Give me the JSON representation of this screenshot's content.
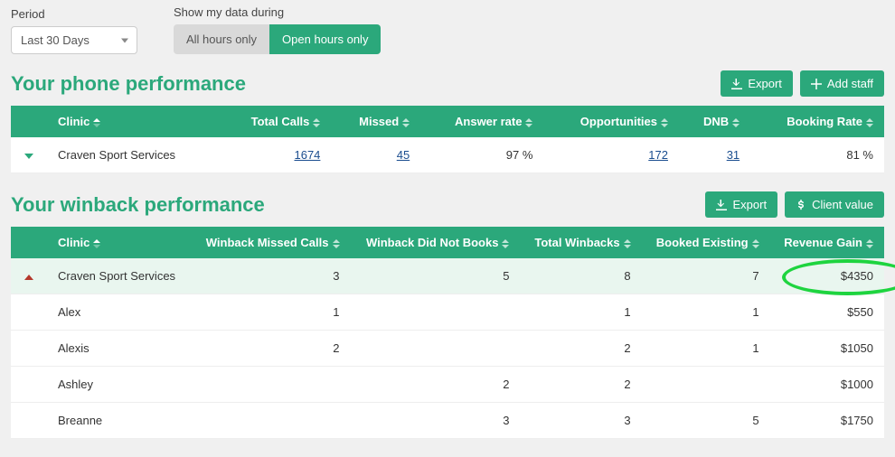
{
  "controls": {
    "period_label": "Period",
    "period_value": "Last 30 Days",
    "hours_label": "Show my data during",
    "hours_opt_all": "All hours only",
    "hours_opt_open": "Open hours only"
  },
  "phone": {
    "title": "Your phone performance",
    "export_label": "Export",
    "add_staff_label": "Add staff",
    "cols": {
      "clinic": "Clinic",
      "total_calls": "Total Calls",
      "missed": "Missed",
      "answer_rate": "Answer rate",
      "opportunities": "Opportunities",
      "dnb": "DNB",
      "booking_rate": "Booking Rate"
    },
    "row": {
      "clinic": "Craven Sport Services",
      "total_calls": "1674",
      "missed": "45",
      "answer_rate": "97 %",
      "opportunities": "172",
      "dnb": "31",
      "booking_rate": "81 %"
    }
  },
  "winback": {
    "title": "Your winback performance",
    "export_label": "Export",
    "client_value_label": "Client value",
    "cols": {
      "clinic": "Clinic",
      "missed": "Winback Missed Calls",
      "dnb": "Winback Did Not Books",
      "total": "Total Winbacks",
      "booked": "Booked Existing",
      "revenue": "Revenue Gain"
    },
    "rows": [
      {
        "clinic": "Craven Sport Services",
        "missed": "3",
        "dnb": "5",
        "total": "8",
        "booked": "7",
        "revenue": "$4350"
      },
      {
        "clinic": "Alex",
        "missed": "1",
        "dnb": "",
        "total": "1",
        "booked": "1",
        "revenue": "$550"
      },
      {
        "clinic": "Alexis",
        "missed": "2",
        "dnb": "",
        "total": "2",
        "booked": "1",
        "revenue": "$1050"
      },
      {
        "clinic": "Ashley",
        "missed": "",
        "dnb": "2",
        "total": "2",
        "booked": "",
        "revenue": "$1000"
      },
      {
        "clinic": "Breanne",
        "missed": "",
        "dnb": "3",
        "total": "3",
        "booked": "5",
        "revenue": "$1750"
      }
    ]
  },
  "colors": {
    "accent": "#2ba87b"
  }
}
